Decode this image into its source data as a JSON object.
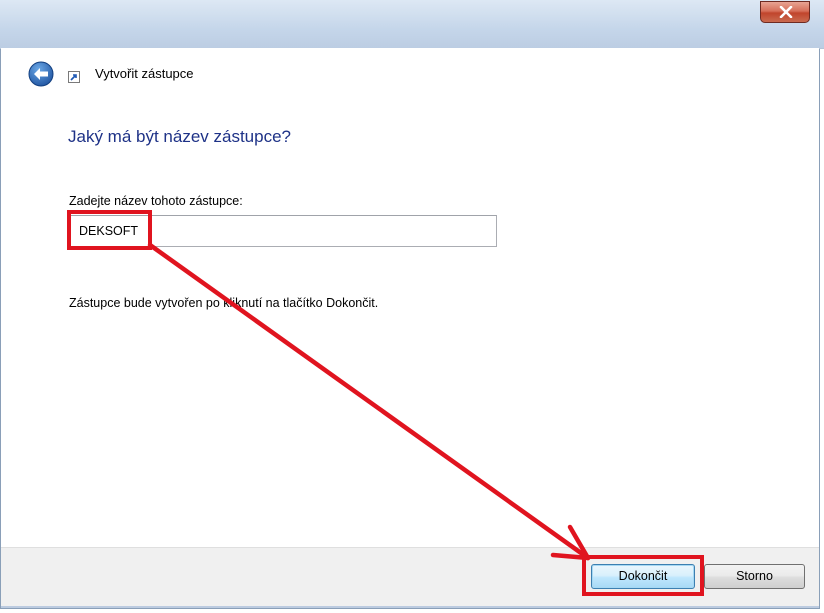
{
  "window": {
    "title_text": "Vytvořit zástupce",
    "close_icon": "close-icon"
  },
  "nav": {
    "back_icon": "back-arrow-icon",
    "shortcut_icon": "shortcut-icon",
    "title": "Vytvořit zástupce"
  },
  "main": {
    "heading": "Jaký má být název zástupce?",
    "field_label": "Zadejte název tohoto zástupce:",
    "field_value": "DEKSOFT",
    "info_text": "Zástupce bude vytvořen po kliknutí na tlačítko Dokončit."
  },
  "footer": {
    "finish_label": "Dokončit",
    "cancel_label": "Storno"
  },
  "annotation": {
    "color": "#e0141f"
  },
  "colors": {
    "heading": "#1e3287",
    "accent": "#3c7fb1",
    "annotation": "#e0141f"
  }
}
